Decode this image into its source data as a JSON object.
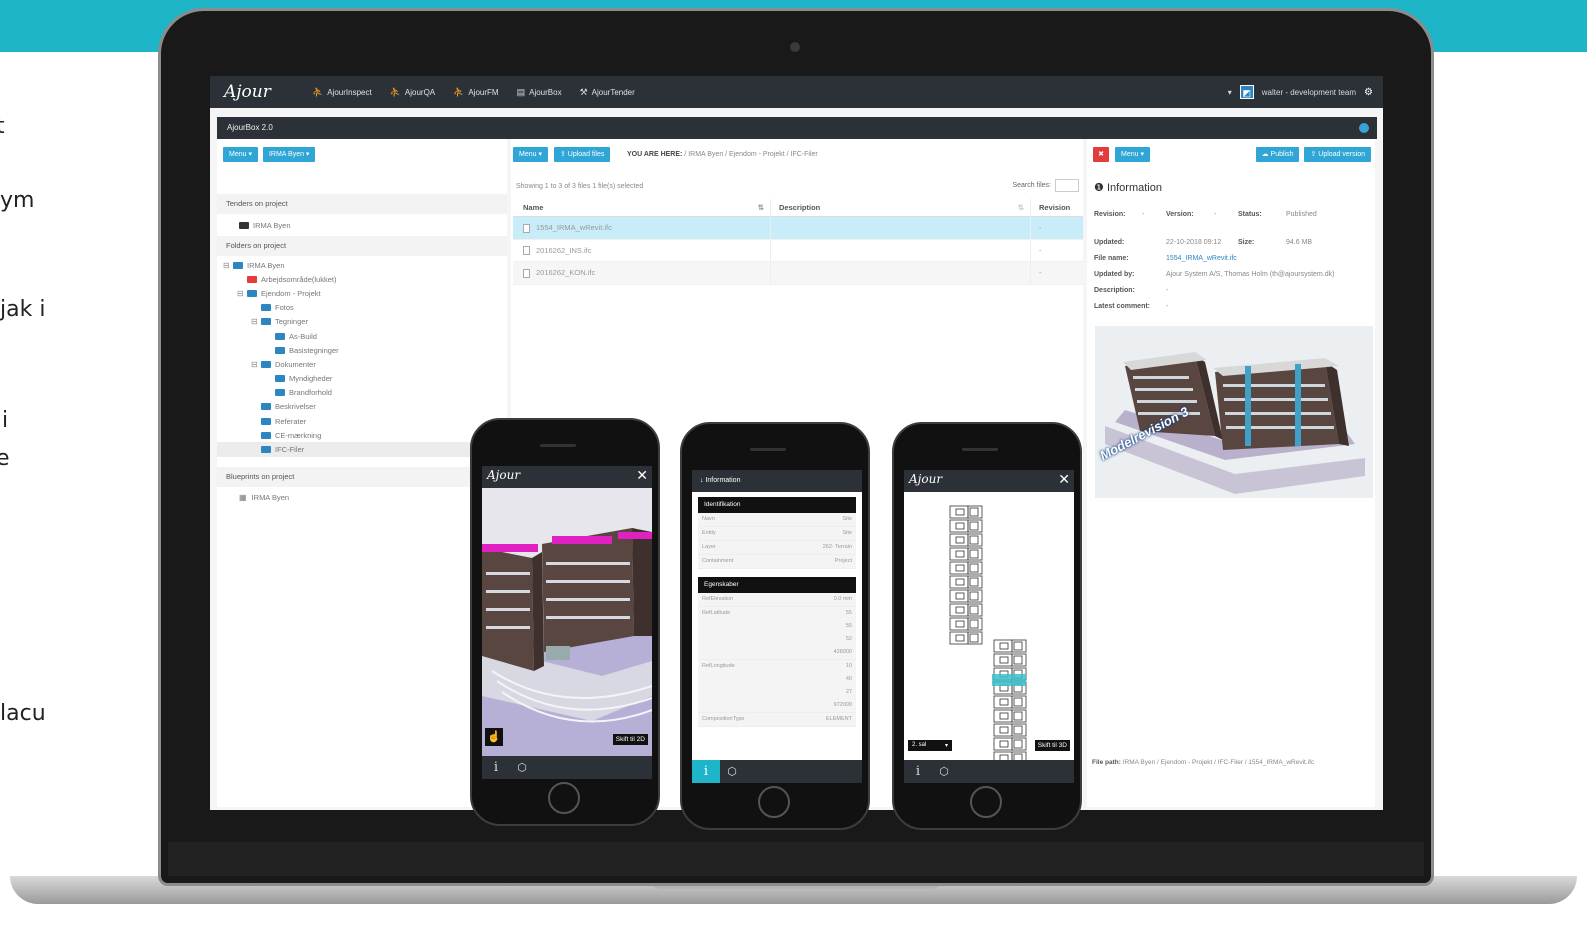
{
  "page_fragments": [
    "t",
    "ym",
    "jak i",
    "i",
    "e",
    "lacu"
  ],
  "nav": {
    "logo": "Ajour",
    "items": [
      {
        "label": "AjourInspect",
        "icon": "people-icon"
      },
      {
        "label": "AjourQA",
        "icon": "people-icon"
      },
      {
        "label": "AjourFM",
        "icon": "people-icon"
      },
      {
        "label": "AjourBox",
        "icon": "box-icon"
      },
      {
        "label": "AjourTender",
        "icon": "gavel-icon"
      }
    ],
    "caret": "▾",
    "user": "walter - development team"
  },
  "app_title": "AjourBox 2.0",
  "left": {
    "menu_label": "Menu ▾",
    "project_label": "IRMA Byen ▾",
    "tenders_header": "Tenders on project",
    "tenders": [
      "IRMA Byen"
    ],
    "folders_header": "Folders on project",
    "folders": [
      {
        "label": "IRMA Byen",
        "toggle": "⊟",
        "level": 0,
        "color": "blue"
      },
      {
        "label": "Arbejdsområde(lukket)",
        "toggle": "",
        "level": 1,
        "color": "red"
      },
      {
        "label": "Ejendom - Projekt",
        "toggle": "⊟",
        "level": 1,
        "color": "blue"
      },
      {
        "label": "Fotos",
        "toggle": "",
        "level": 2,
        "color": "blue"
      },
      {
        "label": "Tegninger",
        "toggle": "⊟",
        "level": 2,
        "color": "blue"
      },
      {
        "label": "As-Build",
        "toggle": "",
        "level": 3,
        "color": "blue"
      },
      {
        "label": "Basistegninger",
        "toggle": "",
        "level": 3,
        "color": "blue"
      },
      {
        "label": "Dokumenter",
        "toggle": "⊟",
        "level": 2,
        "color": "blue"
      },
      {
        "label": "Myndigheder",
        "toggle": "",
        "level": 3,
        "color": "blue"
      },
      {
        "label": "Brandforhold",
        "toggle": "",
        "level": 3,
        "color": "blue"
      },
      {
        "label": "Beskrivelser",
        "toggle": "",
        "level": 2,
        "color": "blue"
      },
      {
        "label": "Referater",
        "toggle": "",
        "level": 2,
        "color": "blue"
      },
      {
        "label": "CE-mærkning",
        "toggle": "",
        "level": 2,
        "color": "blue"
      },
      {
        "label": "IFC-Filer",
        "toggle": "",
        "level": 2,
        "color": "blue",
        "selected": true
      }
    ],
    "blueprints_header": "Blueprints on project",
    "blueprints": [
      "IRMA Byen"
    ]
  },
  "middle": {
    "menu_label": "Menu ▾",
    "upload_label": "⇪ Upload files",
    "breadcrumb_prefix": "YOU ARE HERE:",
    "breadcrumb_path": " / IRMA Byen / Ejendom - Projekt / IFC-Filer",
    "showing": "Showing 1 to 3 of 3 files   1 file(s) selected",
    "search_label": "Search files:",
    "columns": [
      "Name",
      "Description",
      "Revision"
    ],
    "sort_icon": "⇅",
    "rows": [
      {
        "name": "1554_IRMA_wRevit.ifc",
        "description": "",
        "revision": "-"
      },
      {
        "name": "2016262_INS.ifc",
        "description": "",
        "revision": "-"
      },
      {
        "name": "2016262_KON.ifc",
        "description": "",
        "revision": "-"
      }
    ]
  },
  "right": {
    "close": "✖",
    "menu_label": "Menu ▾",
    "publish_label": "☁ Publish",
    "upload_version_label": "⇪ Upload version",
    "info_title": "Information",
    "info_icon": "❶",
    "revision_label": "Revision:",
    "revision": "-",
    "version_label": "Version:",
    "version": "-",
    "status_label": "Status:",
    "status": "Published",
    "updated_label": "Updated:",
    "updated": "22-10-2018 09:12",
    "size_label": "Size:",
    "size": "94.6 MB",
    "filename_label": "File name:",
    "filename": "1554_IRMA_wRevit.ifc",
    "updatedby_label": "Updated by:",
    "updatedby": "Ajour System A/S, Thomas Holm (th@ajoursystem.dk)",
    "description_label": "Description:",
    "description": "-",
    "comment_label": "Latest comment:",
    "comment": "-",
    "render_caption": "Modelrevision 3",
    "filepath_label": "File path:",
    "filepath": " IRMA Byen / Ejendom - Projekt / IFC-Filer / 1554_IRMA_wRevit.ifc"
  },
  "phone1": {
    "logo": "Ajour",
    "close": "✕",
    "skift": "Skift til 2D",
    "info": "i",
    "cube": "⬡",
    "hand": "☝"
  },
  "phone2": {
    "header": "↓  Information",
    "sec1": "Identifikation",
    "sec1_rows": [
      {
        "k": "Navn",
        "v": "Site"
      },
      {
        "k": "Entity",
        "v": "Site"
      },
      {
        "k": "Layer",
        "v": "262- Terrain"
      },
      {
        "k": "Containment",
        "v": "Project"
      }
    ],
    "sec2": "Egenskaber",
    "sec2_rows": [
      {
        "k": "RefElevation",
        "v": "0.0 mm"
      },
      {
        "k": "RefLatitude",
        "v": "55\n55\n52\n428000"
      },
      {
        "k": "RefLongitude",
        "v": "10\n40\n27\n972000"
      },
      {
        "k": "CompositionType",
        "v": "ELEMENT"
      }
    ],
    "info": "i",
    "cube": "⬡"
  },
  "phone3": {
    "logo": "Ajour",
    "close": "✕",
    "skift": "Skift til 3D",
    "select": "2. sal",
    "info": "i",
    "cube": "⬡"
  }
}
